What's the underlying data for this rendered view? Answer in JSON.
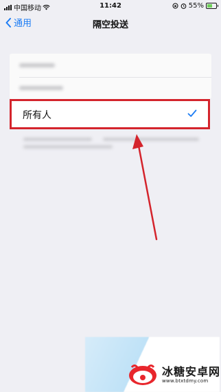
{
  "status_bar": {
    "carrier": "中国移动",
    "time": "11:42",
    "battery": "55%",
    "battery_level": 0.55
  },
  "nav": {
    "back_label": "通用",
    "title": "隔空投送"
  },
  "options": {
    "selected_label": "所有人",
    "selected_icon": "checkmark-icon"
  },
  "watermark": {
    "brand": "冰糖安卓网",
    "url": "www.btxtdmy.com"
  },
  "colors": {
    "accent": "#1c7cf4",
    "annotation": "#d4242c",
    "background": "#efeff4"
  }
}
